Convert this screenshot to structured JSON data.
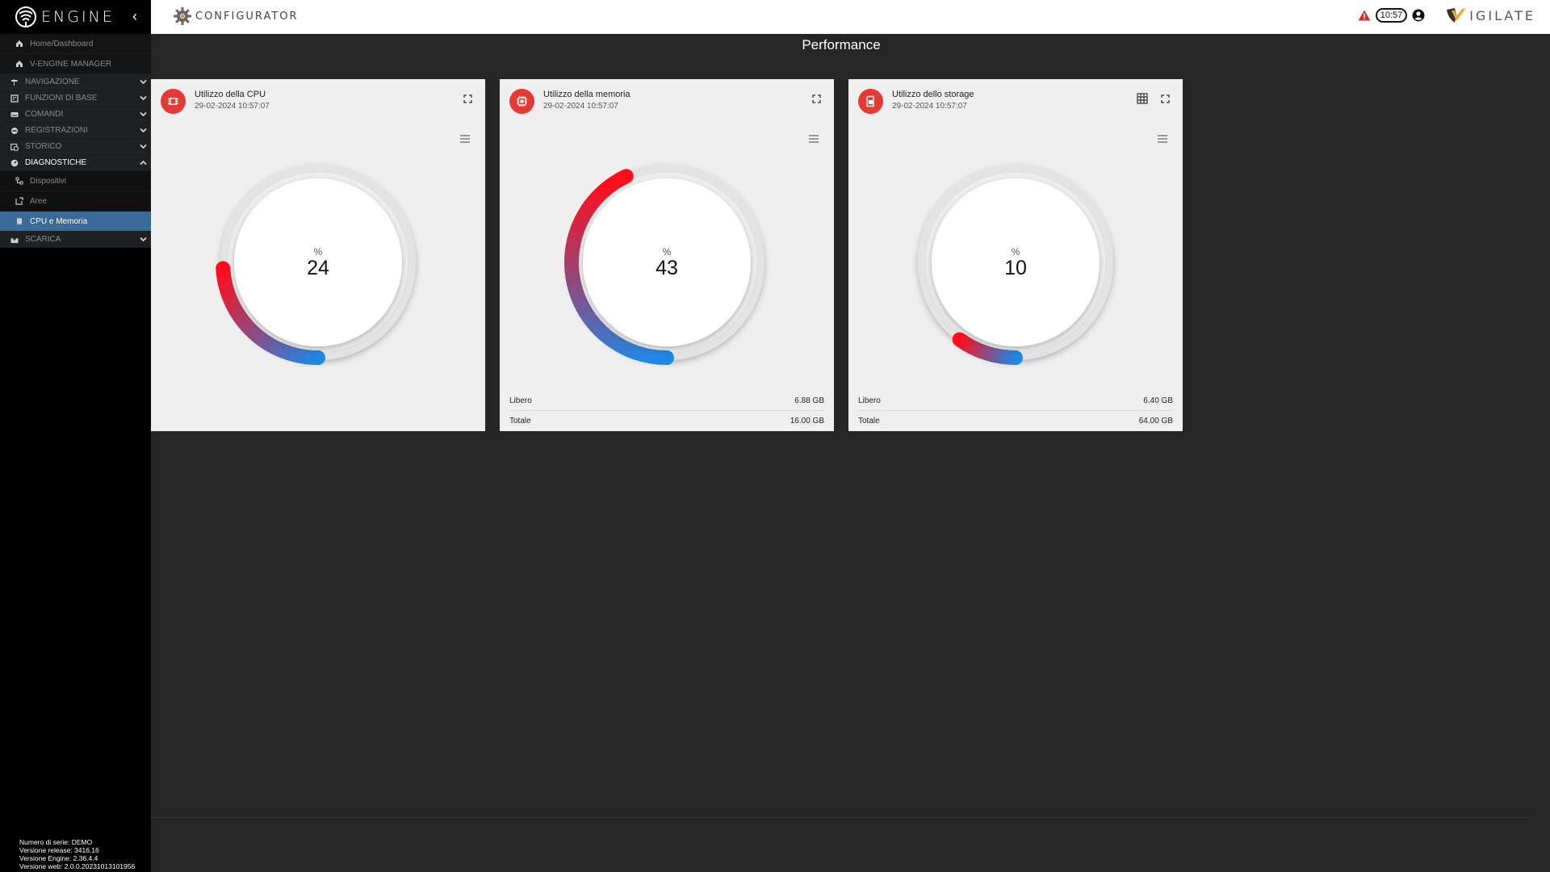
{
  "brand": {
    "name": "ENGINE"
  },
  "sidebar": {
    "items": [
      {
        "label": "Home/Dashboard",
        "type": "home"
      },
      {
        "label": "V-ENGINE MANAGER",
        "type": "home"
      },
      {
        "label": "NAVIGAZIONE",
        "type": "section"
      },
      {
        "label": "FUNZIONI DI BASE",
        "type": "section"
      },
      {
        "label": "COMANDI",
        "type": "section"
      },
      {
        "label": "REGISTRAZIONI",
        "type": "section"
      },
      {
        "label": "STORICO",
        "type": "section"
      },
      {
        "label": "DIAGNOSTICHE",
        "type": "section",
        "open": true
      },
      {
        "label": "Dispositivi",
        "type": "sub"
      },
      {
        "label": "Aree",
        "type": "sub"
      },
      {
        "label": "CPU e Memoria",
        "type": "sub",
        "active": true
      },
      {
        "label": "SCARICA",
        "type": "section"
      }
    ],
    "version": {
      "serial": "Numero di serie: DEMO",
      "release": "Versione release: 3416.16",
      "engine": "Versione Engine: 2.36.4.4",
      "web": "Versione web: 2.0.0.20231013101956"
    }
  },
  "topbar": {
    "app_name": "CONFIGURATOR",
    "clock": "10:57",
    "partner": "IGILATE"
  },
  "page": {
    "title": "Performance"
  },
  "cards": [
    {
      "title": "Utilizzo della CPU",
      "date": "29-02-2024 10:57:07",
      "unit": "%",
      "value": "24",
      "percent": 24
    },
    {
      "title": "Utilizzo della memoria",
      "date": "29-02-2024 10:57:07",
      "unit": "%",
      "value": "43",
      "percent": 43,
      "free_label": "Libero",
      "free_value": "6.88 GB",
      "total_label": "Totale",
      "total_value": "16.00 GB"
    },
    {
      "title": "Utilizzo dello storage",
      "date": "29-02-2024 10:57:07",
      "unit": "%",
      "value": "10",
      "percent": 10,
      "free_label": "Libero",
      "free_value": "6.40 GB",
      "total_label": "Totale",
      "total_value": "64.00 GB"
    }
  ],
  "colors": {
    "accent": "#e53935",
    "active_nav": "#3a6a98",
    "gauge_start": "#1e88e5",
    "gauge_end": "#ff0d1a"
  }
}
